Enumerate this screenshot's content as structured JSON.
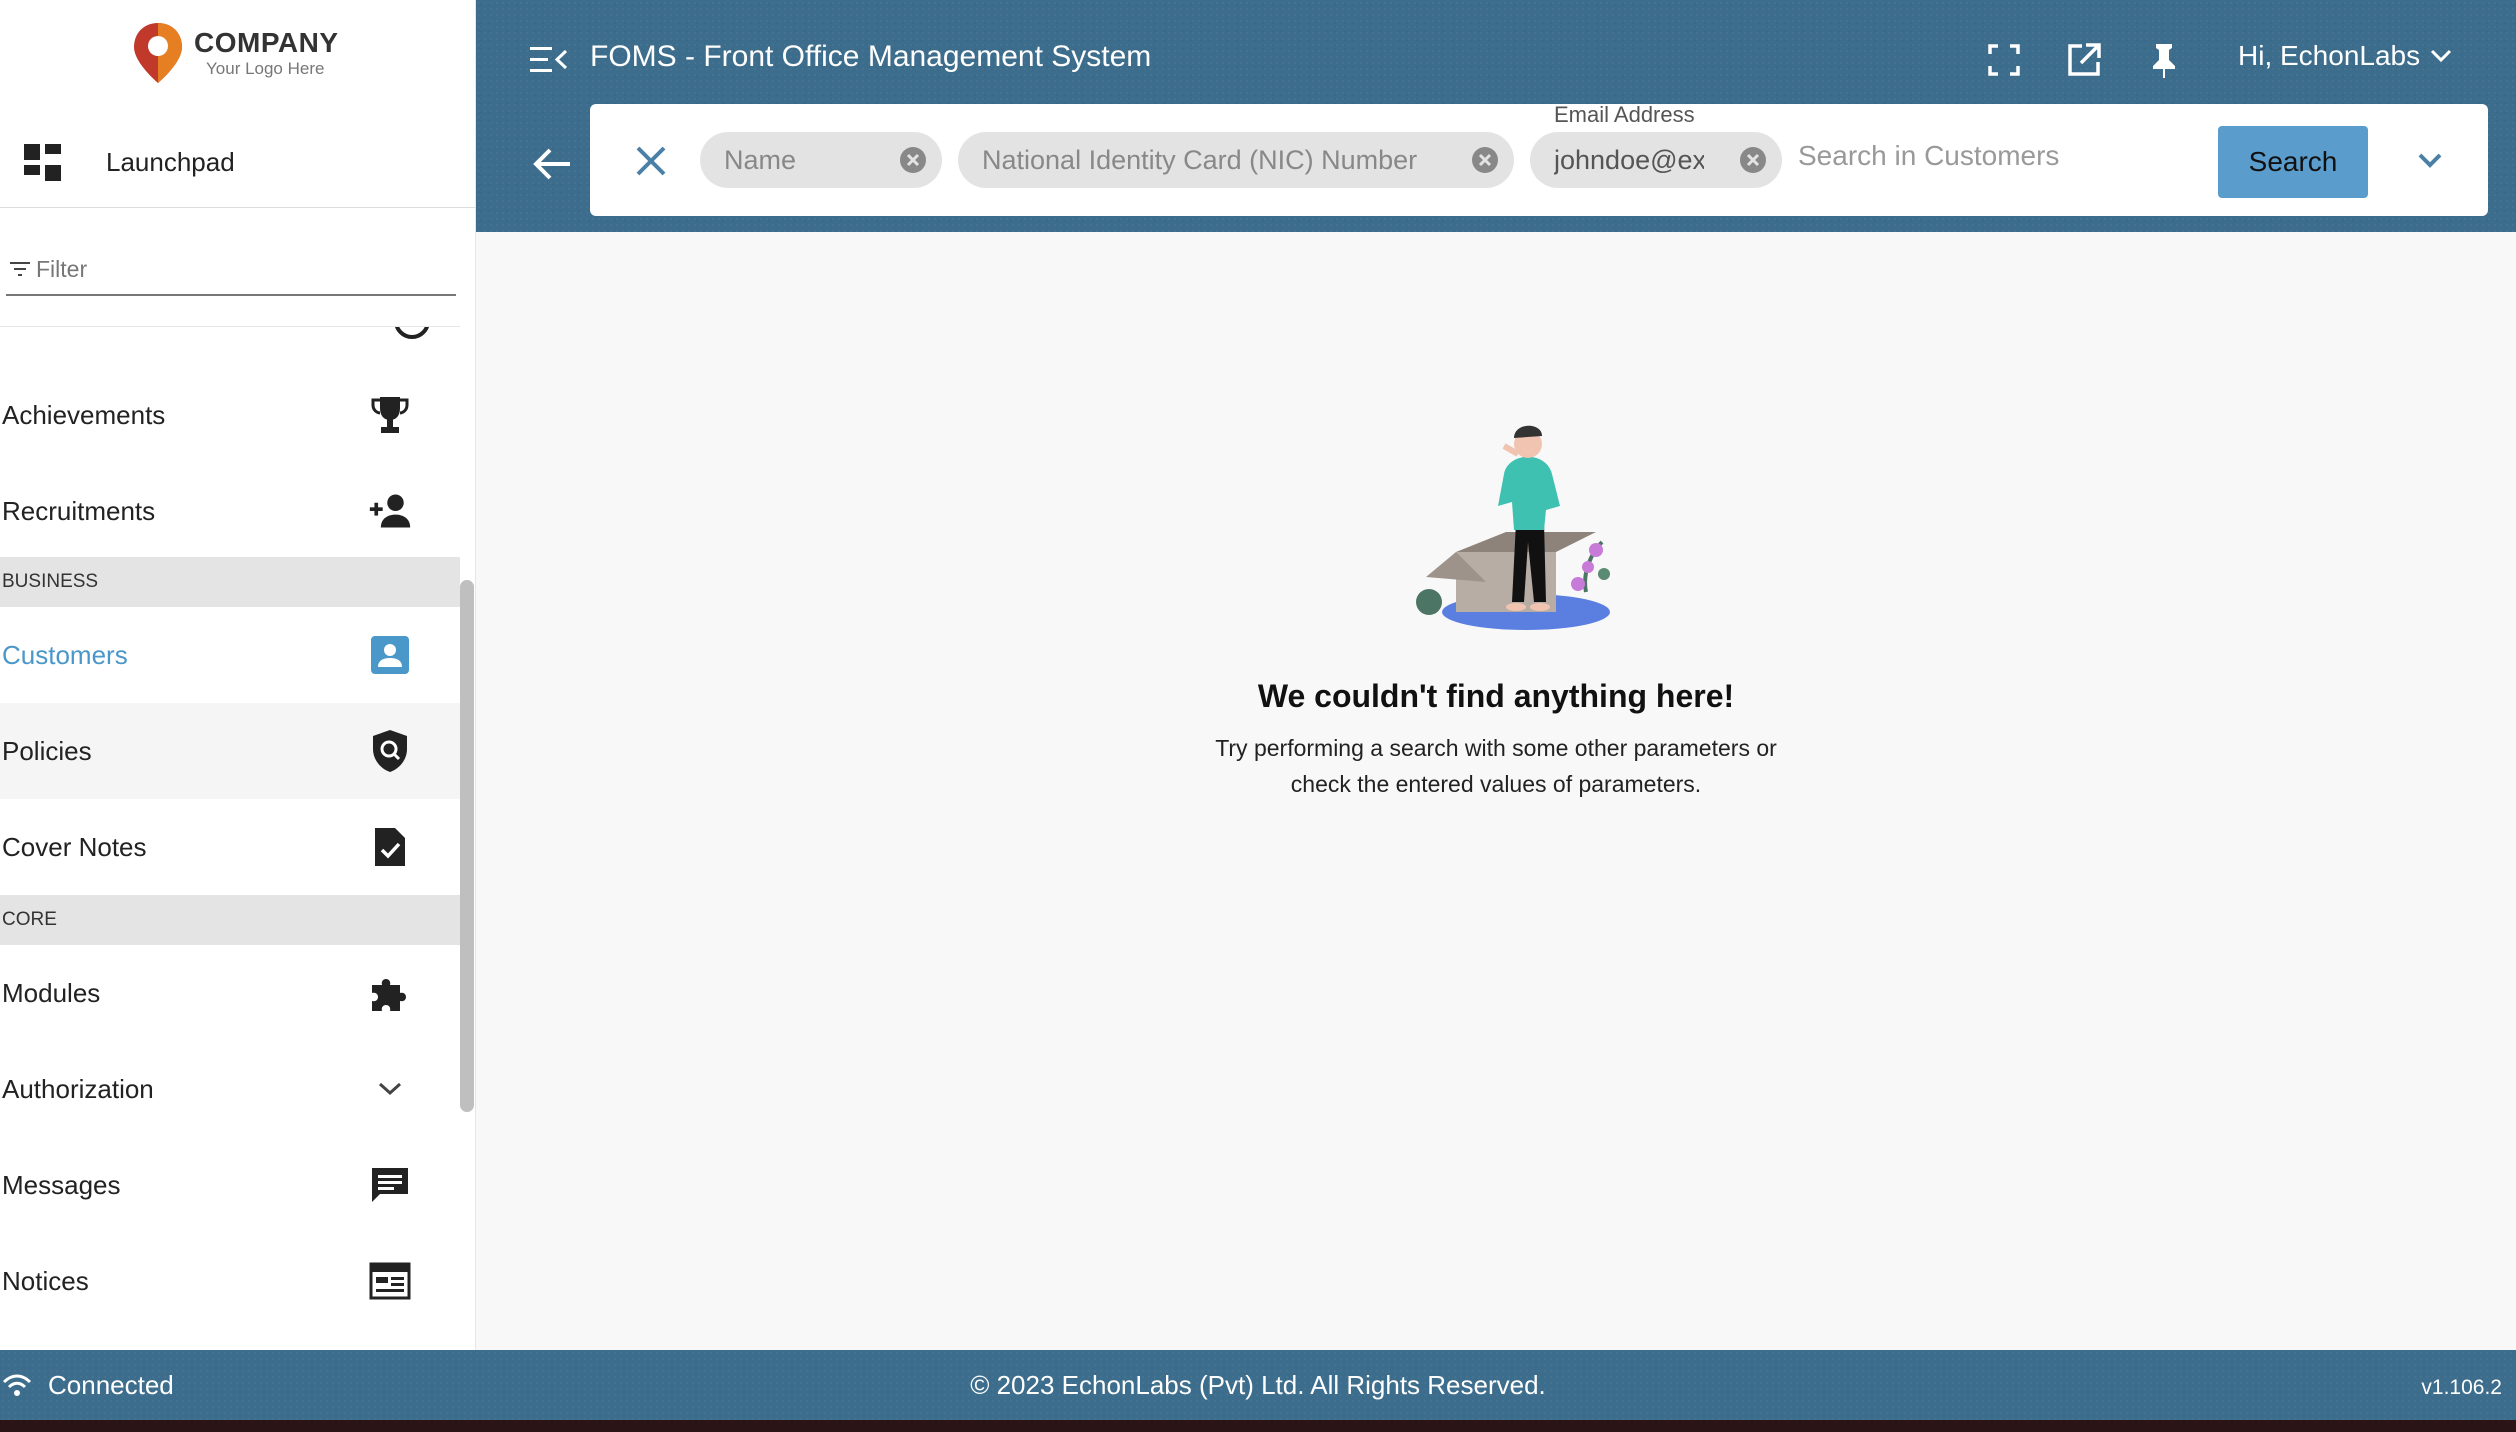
{
  "logo": {
    "name": "COMPANY",
    "tagline": "Your Logo Here"
  },
  "sidebar": {
    "launchpad_label": "Launchpad",
    "filter_placeholder": "Filter",
    "items": [
      {
        "label": "Achievements",
        "icon": "trophy-icon"
      },
      {
        "label": "Recruitments",
        "icon": "person-add-icon"
      },
      {
        "label": "Customers",
        "icon": "contact-card-icon",
        "active": true
      },
      {
        "label": "Policies",
        "icon": "shield-search-icon"
      },
      {
        "label": "Cover Notes",
        "icon": "document-check-icon"
      },
      {
        "label": "Modules",
        "icon": "puzzle-icon"
      },
      {
        "label": "Authorization",
        "icon": "chevron-down-icon"
      },
      {
        "label": "Messages",
        "icon": "message-icon"
      },
      {
        "label": "Notices",
        "icon": "notice-board-icon"
      }
    ],
    "sections": {
      "business": "BUSINESS",
      "core": "CORE"
    }
  },
  "header": {
    "title": "FOMS - Front Office Management System",
    "user_greeting": "Hi, EchonLabs"
  },
  "search": {
    "chips": [
      {
        "text": "Name"
      },
      {
        "text": "National Identity Card (NIC) Number"
      },
      {
        "text": "johndoe@ex",
        "label": "Email Address"
      }
    ],
    "placeholder": "Search in Customers",
    "button_label": "Search"
  },
  "empty_state": {
    "title": "We couldn't find anything here!",
    "line1": "Try performing a search with some other parameters or",
    "line2": "check the entered values of parameters."
  },
  "footer": {
    "status": "Connected",
    "copyright": "© 2023 EchonLabs (Pvt) Ltd. All Rights Reserved.",
    "version": "v1.106.2"
  },
  "colors": {
    "accent": "#4a97c9",
    "header_bg": "#3d6d8c",
    "search_button": "#5a9ccc"
  }
}
